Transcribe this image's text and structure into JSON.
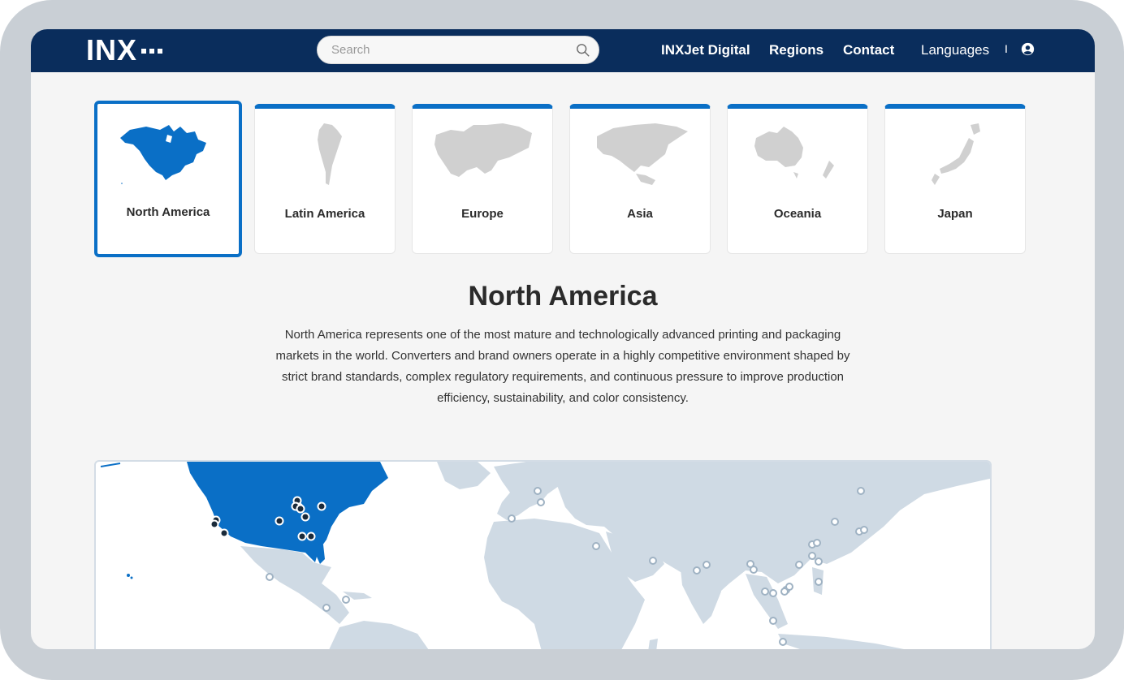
{
  "brand": {
    "logo_text": "INX"
  },
  "search": {
    "placeholder": "Search"
  },
  "nav": {
    "links": [
      "INXJet Digital",
      "Regions",
      "Contact",
      "Languages"
    ],
    "separator": "I"
  },
  "regions": [
    {
      "label": "North America",
      "selected": true
    },
    {
      "label": "Latin America",
      "selected": false
    },
    {
      "label": "Europe",
      "selected": false
    },
    {
      "label": "Asia",
      "selected": false
    },
    {
      "label": "Oceania",
      "selected": false
    },
    {
      "label": "Japan",
      "selected": false
    }
  ],
  "main": {
    "title": "North America",
    "description": "North America represents one of the most mature and technologically advanced printing and packaging markets in the world. Converters and brand owners operate in a highly competitive environment shaped by strict brand standards, complex regulatory requirements, and continuous pressure to improve production efficiency, sustainability, and color consistency."
  },
  "colors": {
    "nav_bg": "#0a2d5c",
    "accent": "#0a6fc6",
    "land_inactive": "#cfdae4",
    "card_map_inactive": "#d0d0d0"
  },
  "icons": {
    "search": "search-icon",
    "user": "user-circle-icon"
  }
}
